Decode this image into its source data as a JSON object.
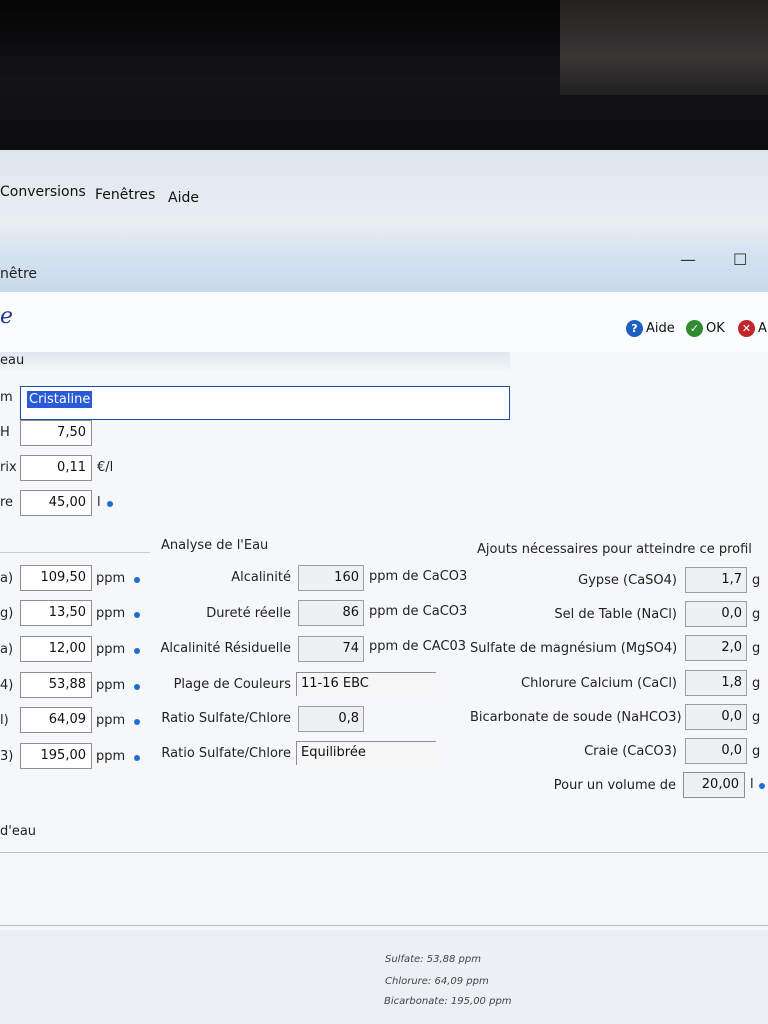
{
  "menu": {
    "conversions": "Conversions",
    "fenetres": "Fenêtres",
    "aide": "Aide"
  },
  "window": {
    "title": "nêtre",
    "minimize": "—",
    "maximize": "☐"
  },
  "header": {
    "title": "e",
    "help": "Aide",
    "ok": "OK",
    "cancel": "A"
  },
  "group": {
    "title": "eau"
  },
  "fields": {
    "name_label": "m",
    "name_value": "Cristaline",
    "ph_label": "H",
    "ph_value": "7,50",
    "price_label": "rix",
    "price_value": "0,11",
    "price_unit": "€/l",
    "volume_label": "re",
    "volume_value": "45,00",
    "volume_unit": "l"
  },
  "ions": [
    {
      "label": "a)",
      "value": "109,50",
      "unit": "ppm"
    },
    {
      "label": "g)",
      "value": "13,50",
      "unit": "ppm"
    },
    {
      "label": "a)",
      "value": "12,00",
      "unit": "ppm"
    },
    {
      "label": "4)",
      "value": "53,88",
      "unit": "ppm"
    },
    {
      "label": "l)",
      "value": "64,09",
      "unit": "ppm"
    },
    {
      "label": "3)",
      "value": "195,00",
      "unit": "ppm"
    }
  ],
  "analysis": {
    "title": "Analyse de l'Eau",
    "rows": [
      {
        "label": "Alcalinité",
        "value": "160",
        "unit": "ppm de CaCO3"
      },
      {
        "label": "Dureté réelle",
        "value": "86",
        "unit": "ppm de CaCO3"
      },
      {
        "label": "Alcalinité Résiduelle",
        "value": "74",
        "unit": "ppm de CAC03"
      },
      {
        "label": "Plage de Couleurs",
        "value": "11-16 EBC",
        "unit": ""
      },
      {
        "label": "Ratio Sulfate/Chlore",
        "value": "0,8",
        "unit": ""
      },
      {
        "label": "Ratio Sulfate/Chlore",
        "value": "Equilibrée",
        "unit": ""
      }
    ]
  },
  "additions": {
    "title": "Ajouts nécessaires pour atteindre ce profil",
    "rows": [
      {
        "label": "Gypse (CaSO4)",
        "value": "1,7",
        "unit": "g"
      },
      {
        "label": "Sel de Table (NaCl)",
        "value": "0,0",
        "unit": "g"
      },
      {
        "label": "Sulfate de magnésium (MgSO4)",
        "value": "2,0",
        "unit": "g"
      },
      {
        "label": "Chlorure  Calcium (CaCl)",
        "value": "1,8",
        "unit": "g"
      },
      {
        "label": "Bicarbonate de soude (NaHCO3)",
        "value": "0,0",
        "unit": "g"
      },
      {
        "label": "Craie (CaCO3)",
        "value": "0,0",
        "unit": "g"
      }
    ],
    "volume_label": "Pour un volume de",
    "volume_value": "20,00",
    "volume_unit": "l"
  },
  "footer": {
    "label": "d'eau"
  },
  "status": {
    "line1": "Sulfate: 53,88 ppm",
    "line2": "Chlorure: 64,09 ppm",
    "line3": "Bicarbonate: 195,00 ppm"
  }
}
